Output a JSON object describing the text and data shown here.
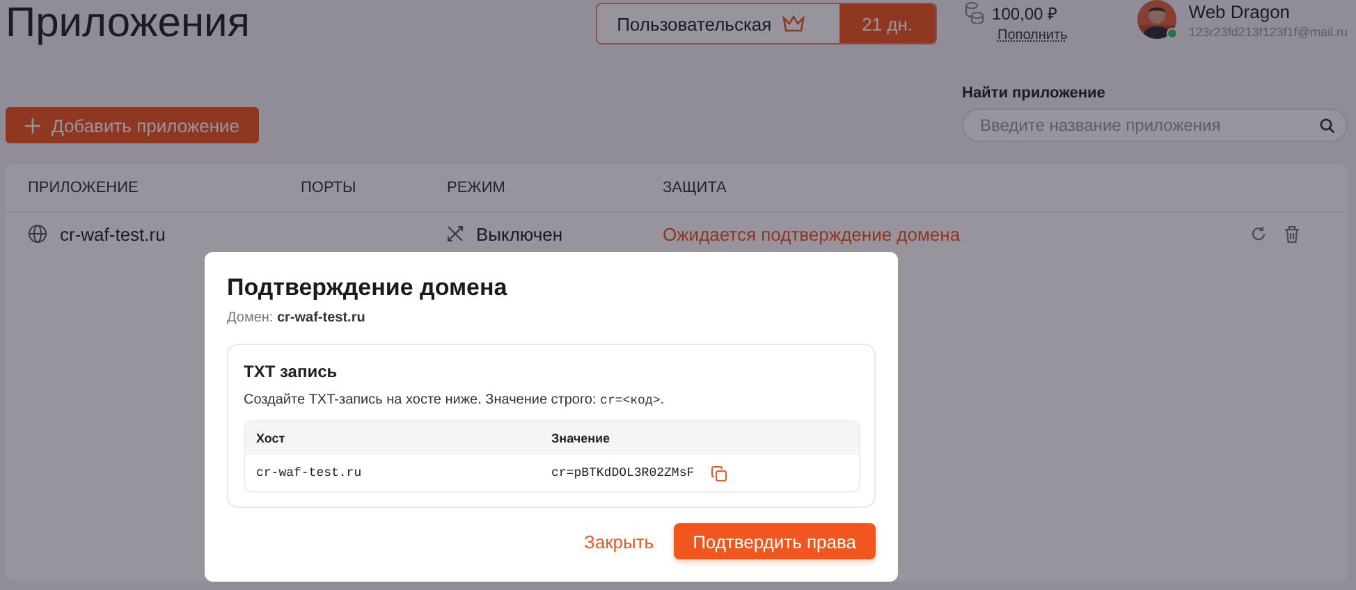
{
  "page": {
    "title": "Приложения"
  },
  "header": {
    "plan": {
      "name": "Пользовательская",
      "days": "21 дн."
    },
    "balance": {
      "amount": "100,00 ₽",
      "topup": "Пополнить"
    },
    "user": {
      "name": "Web Dragon",
      "email": "123r23fd213f123f1f@mail.ru",
      "online": true
    }
  },
  "toolbar": {
    "add_button": "Добавить приложение",
    "search": {
      "label": "Найти приложение",
      "placeholder": "Введите название приложения"
    }
  },
  "table": {
    "columns": [
      "ПРИЛОЖЕНИЕ",
      "ПОРТЫ",
      "РЕЖИМ",
      "ЗАЩИТА"
    ],
    "rows": [
      {
        "name": "cr-waf-test.ru",
        "mode": "Выключен",
        "protection": "Ожидается подтверждение домена"
      }
    ]
  },
  "dialog": {
    "title": "Подтверждение домена",
    "domain": "Домен: **cr-waf-test.ru**",
    "record": {
      "title": "TXT запись",
      "text_before": "Создайте TXT-запись на хосте ниже. Значение строго: ",
      "code": "cr=<код>",
      "text_after": ".",
      "columns": [
        "Хост",
        "Значение"
      ],
      "rows": [
        {
          "host": "cr-waf-test.ru",
          "value": "cr=pBTKdDOL3R02ZMsF"
        }
      ]
    },
    "buttons": [
      {
        "label": "Закрыть",
        "kind": "secondary"
      },
      {
        "label": "Подтвердить права",
        "kind": "primary"
      }
    ]
  }
}
